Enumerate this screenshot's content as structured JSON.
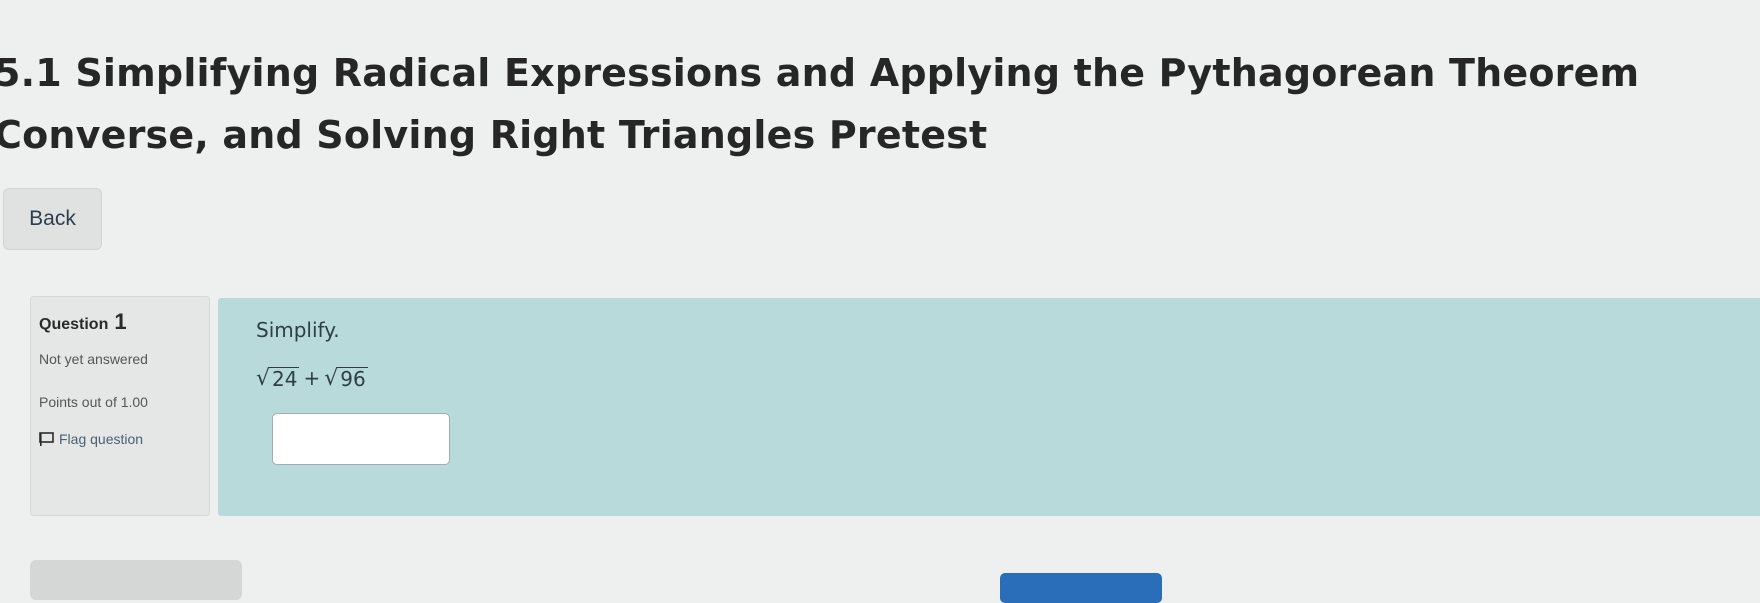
{
  "page": {
    "title": "5.1 Simplifying Radical Expressions and Applying the Pythagorean Theorem Converse, and Solving Right Triangles Pretest",
    "back_label": "Back"
  },
  "question": {
    "label": "Question",
    "number": "1",
    "status": "Not yet answered",
    "points": "Points out of 1.00",
    "flag_label": "Flag question",
    "prompt": "Simplify.",
    "expression": {
      "radical_sign": "√",
      "term1": "24",
      "operator": "+",
      "term2": "96"
    },
    "answer_value": ""
  },
  "icons": {
    "flag": "flag-icon"
  },
  "colors": {
    "content_bg": "#b8dada",
    "info_bg": "#e5e7e6",
    "page_bg": "#eef0ef",
    "primary_button": "#2a6db8"
  }
}
